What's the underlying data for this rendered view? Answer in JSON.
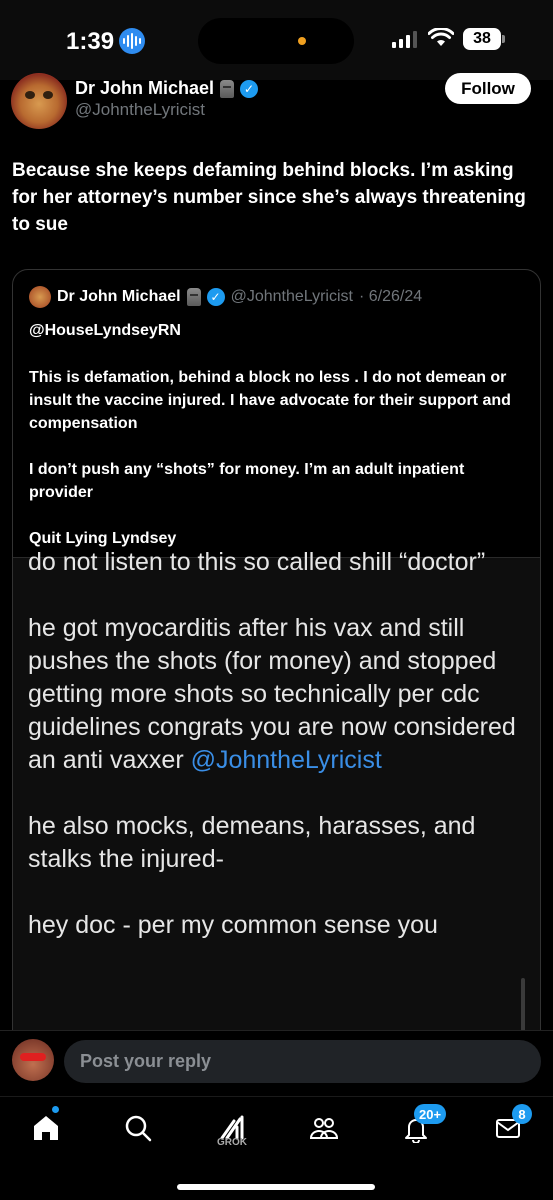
{
  "status_bar": {
    "time": "1:39",
    "battery": "38"
  },
  "header": {
    "display_name": "Dr John Michael",
    "handle": "@JohntheLyricist",
    "follow_label": "Follow"
  },
  "post": {
    "text": "Because she keeps defaming behind blocks.  I’m asking for her attorney’s number since she’s always threatening to sue"
  },
  "quoted_post": {
    "display_name": "Dr John Michael",
    "handle": "@JohntheLyricist",
    "date": "· 6/26/24",
    "mention": "@HouseLyndseyRN",
    "paragraphs": [
      "This is defamation, behind a block no less .  I do not demean or insult the vaccine injured. I have advocate for their support and compensation",
      "I don’t push any “shots” for money. I’m an adult inpatient provider",
      "Quit Lying Lyndsey"
    ],
    "image_text": {
      "line1": "do not listen to this so called shill “doctor”",
      "line2_before": "he got myocarditis after his vax and still pushes the shots (for money) and stopped getting more shots so technically per cdc guidelines congrats you are now considered an anti vaxxer ",
      "line2_link": "@JohntheLyricist",
      "line3": "he also mocks, demeans, harasses, and stalks the injured-",
      "line4": "hey doc - per my common sense you"
    }
  },
  "reply": {
    "placeholder": "Post your reply"
  },
  "tab_bar": {
    "items": [
      "home-icon",
      "search-icon",
      "grok-icon",
      "communities-icon",
      "notifications-icon",
      "messages-icon"
    ],
    "grok_label": "GROK",
    "notifications_badge": "20+",
    "messages_badge": "8"
  },
  "colors": {
    "accent": "#1d9bf0",
    "background": "#000000",
    "muted": "#71767b"
  }
}
